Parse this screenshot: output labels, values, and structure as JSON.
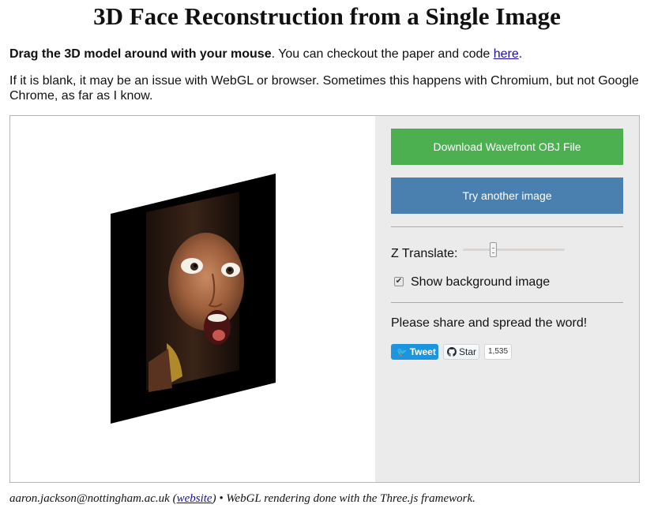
{
  "page": {
    "title": "3D Face Reconstruction from a Single Image"
  },
  "intro": {
    "bold_text": "Drag the 3D model around with your mouse",
    "text": ". You can checkout the paper and code ",
    "link_text": "here",
    "end": "."
  },
  "note": {
    "text": "If it is blank, it may be an issue with WebGL or browser. Sometimes this happens with Chromium, but not Google Chrome, as far as I know."
  },
  "controls": {
    "download_label": "Download Wavefront OBJ File",
    "another_label": "Try another image",
    "z_translate_label": "Z Translate:",
    "z_translate_value": 0.3,
    "show_bg_label": "Show background image",
    "show_bg_checked": true,
    "share_text": "Please share and spread the word!",
    "tweet_label": "Tweet",
    "star_label": "Star",
    "star_count": "1,535"
  },
  "colors": {
    "download_button": "#4caf50",
    "another_button": "#4a80b0",
    "panel_bg": "#ebebeb",
    "tweet_button": "#1b95e0"
  },
  "footer": {
    "email": "aaron.jackson@nottingham.ac.uk",
    "open_paren": " (",
    "link_text": "website",
    "close_paren": ")",
    "rest": " • WebGL rendering done with the Three.js framework."
  }
}
